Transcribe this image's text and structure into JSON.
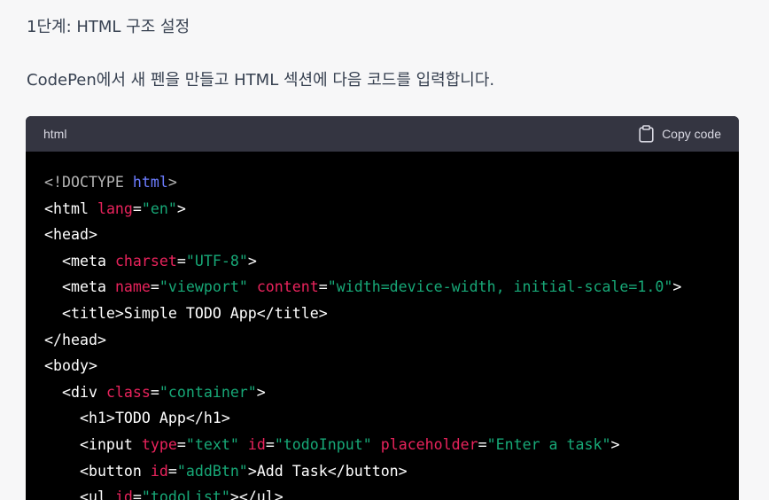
{
  "content": {
    "step_heading": "1단계: HTML 구조 설정",
    "intro": "CodePen에서 새 펜을 만들고 HTML 섹션에 다음 코드를 입력합니다."
  },
  "code_block": {
    "language": "html",
    "copy_label": "Copy code",
    "lines": [
      [
        {
          "t": "<!DOCTYPE ",
          "c": "doctype"
        },
        {
          "t": "html",
          "c": "kw"
        },
        {
          "t": ">",
          "c": "doctype"
        }
      ],
      [
        {
          "t": "<html ",
          "c": "tag"
        },
        {
          "t": "lang",
          "c": "attr"
        },
        {
          "t": "=",
          "c": "eq"
        },
        {
          "t": "\"en\"",
          "c": "str"
        },
        {
          "t": ">",
          "c": "tag"
        }
      ],
      [
        {
          "t": "<head>",
          "c": "tag"
        }
      ],
      [
        {
          "t": "  <meta ",
          "c": "tag"
        },
        {
          "t": "charset",
          "c": "attr"
        },
        {
          "t": "=",
          "c": "eq"
        },
        {
          "t": "\"UTF-8\"",
          "c": "str"
        },
        {
          "t": ">",
          "c": "tag"
        }
      ],
      [
        {
          "t": "  <meta ",
          "c": "tag"
        },
        {
          "t": "name",
          "c": "attr"
        },
        {
          "t": "=",
          "c": "eq"
        },
        {
          "t": "\"viewport\"",
          "c": "str"
        },
        {
          "t": " ",
          "c": "tag"
        },
        {
          "t": "content",
          "c": "attr"
        },
        {
          "t": "=",
          "c": "eq"
        },
        {
          "t": "\"width=device-width, initial-scale=1.0\"",
          "c": "str"
        },
        {
          "t": ">",
          "c": "tag"
        }
      ],
      [
        {
          "t": "  <title>",
          "c": "tag"
        },
        {
          "t": "Simple TODO App",
          "c": "text"
        },
        {
          "t": "</title>",
          "c": "tag"
        }
      ],
      [
        {
          "t": "</head>",
          "c": "tag"
        }
      ],
      [
        {
          "t": "<body>",
          "c": "tag"
        }
      ],
      [
        {
          "t": "  <div ",
          "c": "tag"
        },
        {
          "t": "class",
          "c": "attr"
        },
        {
          "t": "=",
          "c": "eq"
        },
        {
          "t": "\"container\"",
          "c": "str"
        },
        {
          "t": ">",
          "c": "tag"
        }
      ],
      [
        {
          "t": "    <h1>",
          "c": "tag"
        },
        {
          "t": "TODO App",
          "c": "text"
        },
        {
          "t": "</h1>",
          "c": "tag"
        }
      ],
      [
        {
          "t": "    <input ",
          "c": "tag"
        },
        {
          "t": "type",
          "c": "attr"
        },
        {
          "t": "=",
          "c": "eq"
        },
        {
          "t": "\"text\"",
          "c": "str"
        },
        {
          "t": " ",
          "c": "tag"
        },
        {
          "t": "id",
          "c": "attr"
        },
        {
          "t": "=",
          "c": "eq"
        },
        {
          "t": "\"todoInput\"",
          "c": "str"
        },
        {
          "t": " ",
          "c": "tag"
        },
        {
          "t": "placeholder",
          "c": "attr"
        },
        {
          "t": "=",
          "c": "eq"
        },
        {
          "t": "\"Enter a task\"",
          "c": "str"
        },
        {
          "t": ">",
          "c": "tag"
        }
      ],
      [
        {
          "t": "    <button ",
          "c": "tag"
        },
        {
          "t": "id",
          "c": "attr"
        },
        {
          "t": "=",
          "c": "eq"
        },
        {
          "t": "\"addBtn\"",
          "c": "str"
        },
        {
          "t": ">",
          "c": "tag"
        },
        {
          "t": "Add Task",
          "c": "text"
        },
        {
          "t": "</button>",
          "c": "tag"
        }
      ],
      [
        {
          "t": "    <ul ",
          "c": "tag"
        },
        {
          "t": "id",
          "c": "attr"
        },
        {
          "t": "=",
          "c": "eq"
        },
        {
          "t": "\"todoList\"",
          "c": "str"
        },
        {
          "t": "></ul>",
          "c": "tag"
        }
      ]
    ]
  },
  "icons": {
    "copy": "clipboard-icon"
  },
  "colors": {
    "page_bg": "#f7f7f8",
    "code_header_bg": "#343541",
    "code_bg": "#000000",
    "syntax_attr": "#e9235c",
    "syntax_string": "#17a877",
    "syntax_keyword": "#6b7cff",
    "syntax_doctype": "#b4b4b4"
  }
}
